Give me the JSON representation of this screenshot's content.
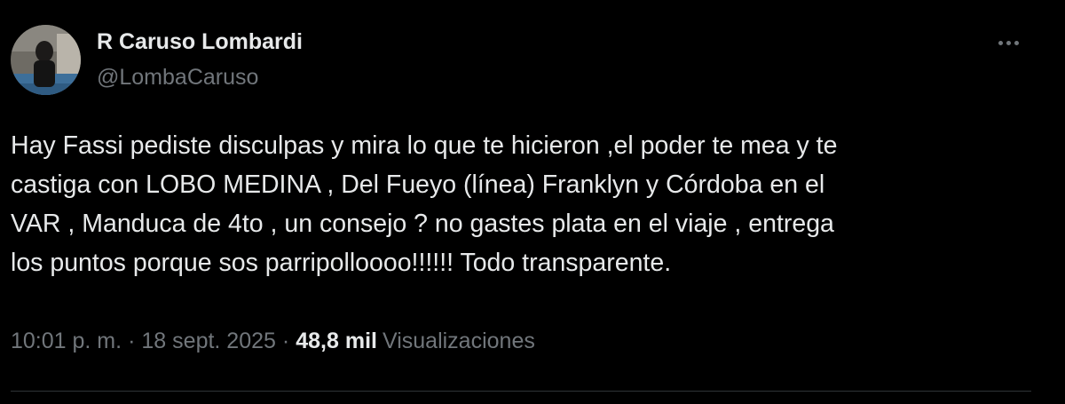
{
  "author": {
    "display_name": "R Caruso Lombardi",
    "handle": "@LombaCaruso"
  },
  "tweet": {
    "text": "Hay Fassi pediste disculpas y mira lo que te hicieron ,el poder te mea y te\ncastiga con LOBO MEDINA , Del Fueyo (línea) Franklyn y Córdoba en el\nVAR , Manduca de 4to , un consejo ? no gastes plata en el viaje , entrega\nlos puntos  porque sos parripolloooo!!!!!! Todo transparente.",
    "time": "10:01 p. m.",
    "separator": "·",
    "date": "18 sept. 2025",
    "views_count": "48,8 mil",
    "views_label": "Visualizaciones"
  },
  "icons": {
    "more": "more-horizontal-icon",
    "avatar": "profile-avatar"
  },
  "colors": {
    "background": "#000000",
    "primary_text": "#e7e9ea",
    "secondary_text": "#71767b",
    "divider": "#2f3336"
  }
}
